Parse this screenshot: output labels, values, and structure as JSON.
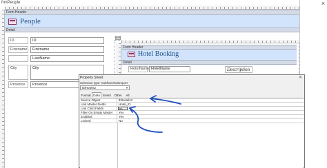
{
  "window": {
    "title": "frmPeople",
    "close_glyph": "×"
  },
  "main_form": {
    "form_header_band": "Form Header",
    "header_title": "People",
    "detail_band": "Detail",
    "fields": [
      {
        "label": "ID",
        "value": "ID"
      },
      {
        "label": "Firstname",
        "value": "Firstname"
      },
      {
        "label": "LastName",
        "value": "LastName"
      },
      {
        "label": "City",
        "value": "City"
      },
      {
        "label": "Province",
        "value": "Province"
      }
    ]
  },
  "subform": {
    "control_name": "tblHotels2",
    "form_header_band": "Form Header",
    "header_title": "Hotel Booking",
    "detail_band": "Detail",
    "field_label": "HotelName",
    "field_value": "HotelName",
    "description_label": "Description"
  },
  "property_sheet": {
    "title": "Property Sheet",
    "selection_type_label": "Selection type: Subform/Subreport",
    "selected_object": "tblHotels2",
    "tabs": [
      "Format",
      "Data",
      "Event",
      "Other",
      "All"
    ],
    "active_tab": "Data",
    "properties": [
      {
        "name": "Source Object",
        "value": "tblHotels2"
      },
      {
        "name": "Link Master Fields",
        "value": "Hotel_ID"
      },
      {
        "name": "Link Child Fields",
        "value": "ID"
      },
      {
        "name": "Filter On Empty Master",
        "value": "Yes"
      },
      {
        "name": "Enabled",
        "value": "Yes"
      },
      {
        "name": "Locked",
        "value": "No"
      }
    ]
  },
  "colors": {
    "header_bg": "#d2e4fb",
    "header_title": "#1f4e8a",
    "band": "#d5dbe6",
    "annotation": "#1f4fbf"
  }
}
